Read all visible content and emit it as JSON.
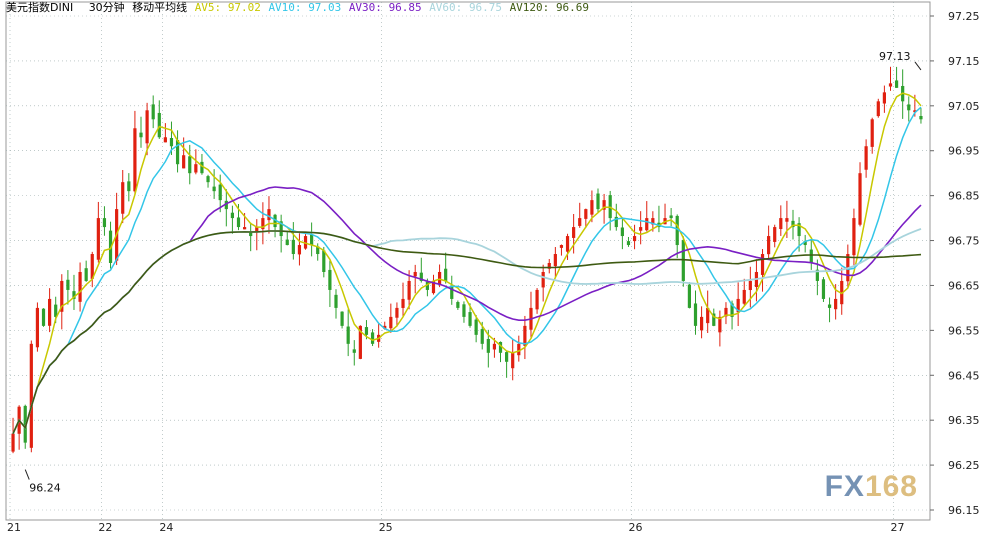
{
  "header": {
    "title": "美元指数DINI",
    "period": "30分钟",
    "indicator": "移动平均线",
    "ma": [
      {
        "label": "AV5:",
        "value": "97.02",
        "color": "#c8c800"
      },
      {
        "label": "AV10:",
        "value": "97.03",
        "color": "#33c6e8"
      },
      {
        "label": "AV30:",
        "value": "96.85",
        "color": "#7a1fc4"
      },
      {
        "label": "AV60:",
        "value": "96.75",
        "color": "#a8d4dc"
      },
      {
        "label": "AV120:",
        "value": "96.69",
        "color": "#3e5a12"
      }
    ]
  },
  "logo": {
    "text_fx": "FX",
    "text_num": "168"
  },
  "chart_data": {
    "type": "candlestick",
    "y_ticks": [
      "97.25",
      "97.15",
      "97.05",
      "96.95",
      "96.85",
      "96.75",
      "96.65",
      "96.55",
      "96.45",
      "96.35",
      "96.25",
      "96.15"
    ],
    "ylim": [
      96.15,
      97.25
    ],
    "x_labels": [
      {
        "label": "21",
        "index": 0
      },
      {
        "label": "22",
        "index": 15
      },
      {
        "label": "24",
        "index": 25
      },
      {
        "label": "25",
        "index": 61
      },
      {
        "label": "26",
        "index": 102
      },
      {
        "label": "27",
        "index": 145
      }
    ],
    "annotations": [
      {
        "text": "97.13",
        "index": 149,
        "value": 97.13,
        "position": "above"
      },
      {
        "text": "96.24",
        "index": 2,
        "value": 96.24,
        "position": "below"
      }
    ],
    "candle_colors": {
      "up": "#e02010",
      "down": "#2ea02e"
    },
    "closes": [
      96.32,
      96.38,
      96.3,
      96.52,
      96.6,
      96.56,
      96.62,
      96.58,
      96.66,
      96.64,
      96.62,
      96.68,
      96.66,
      96.72,
      96.8,
      96.78,
      96.7,
      96.82,
      96.88,
      96.86,
      97.0,
      96.98,
      97.04,
      97.02,
      96.98,
      96.98,
      96.96,
      96.92,
      96.94,
      96.9,
      96.92,
      96.9,
      96.88,
      96.86,
      96.84,
      96.82,
      96.8,
      96.78,
      96.78,
      96.76,
      96.78,
      96.8,
      96.82,
      96.78,
      96.76,
      96.74,
      96.72,
      96.74,
      96.76,
      96.74,
      96.72,
      96.68,
      96.64,
      96.6,
      96.56,
      96.52,
      96.5,
      96.56,
      96.54,
      96.52,
      96.54,
      96.56,
      96.58,
      96.6,
      96.62,
      96.66,
      96.68,
      96.66,
      96.64,
      96.66,
      96.68,
      96.66,
      96.62,
      96.6,
      96.58,
      96.56,
      96.54,
      96.52,
      96.5,
      96.52,
      96.5,
      96.48,
      96.5,
      96.52,
      96.56,
      96.6,
      96.64,
      96.68,
      96.7,
      96.72,
      96.74,
      96.76,
      96.78,
      96.8,
      96.82,
      96.84,
      96.82,
      96.84,
      96.8,
      96.78,
      96.76,
      96.74,
      96.76,
      96.78,
      96.8,
      96.8,
      96.78,
      96.8,
      96.8,
      96.74,
      96.66,
      96.6,
      96.56,
      96.58,
      96.6,
      96.56,
      96.58,
      96.6,
      96.58,
      96.62,
      96.64,
      96.66,
      96.68,
      96.72,
      96.76,
      96.78,
      96.8,
      96.8,
      96.78,
      96.76,
      96.74,
      96.7,
      96.66,
      96.62,
      96.6,
      96.62,
      96.66,
      96.72,
      96.8,
      96.9,
      96.96,
      97.02,
      97.06,
      97.08,
      97.1,
      97.09,
      97.06,
      97.04,
      97.04,
      97.02
    ]
  }
}
